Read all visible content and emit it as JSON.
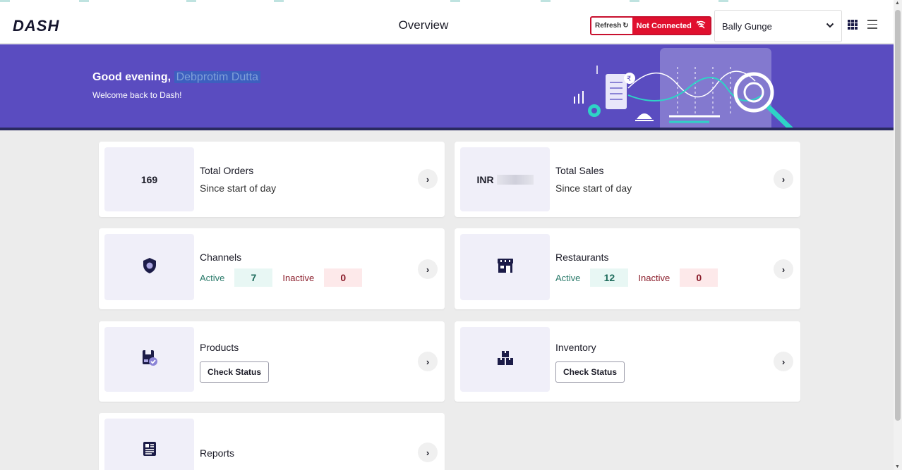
{
  "header": {
    "logo": "DASH",
    "page_title": "Overview",
    "refresh_label": "Refresh",
    "connection_status": "Not Connected",
    "branch": "Bally Gunge"
  },
  "banner": {
    "greeting": "Good evening,",
    "user_name": "Debprotim Dutta",
    "welcome": "Welcome back to Dash!"
  },
  "cards": {
    "orders": {
      "value": "169",
      "title": "Total Orders",
      "subtitle": "Since start of day"
    },
    "sales": {
      "currency": "INR",
      "title": "Total Sales",
      "subtitle": "Since start of day"
    },
    "channels": {
      "title": "Channels",
      "active_label": "Active",
      "active": "7",
      "inactive_label": "Inactive",
      "inactive": "0"
    },
    "restaurants": {
      "title": "Restaurants",
      "active_label": "Active",
      "active": "12",
      "inactive_label": "Inactive",
      "inactive": "0"
    },
    "products": {
      "title": "Products",
      "button": "Check Status"
    },
    "inventory": {
      "title": "Inventory",
      "button": "Check Status"
    },
    "reports": {
      "title": "Reports"
    }
  },
  "colors": {
    "banner": "#5a4cc0",
    "not_connected": "#e0102e",
    "icon_navy": "#1c1c48"
  }
}
